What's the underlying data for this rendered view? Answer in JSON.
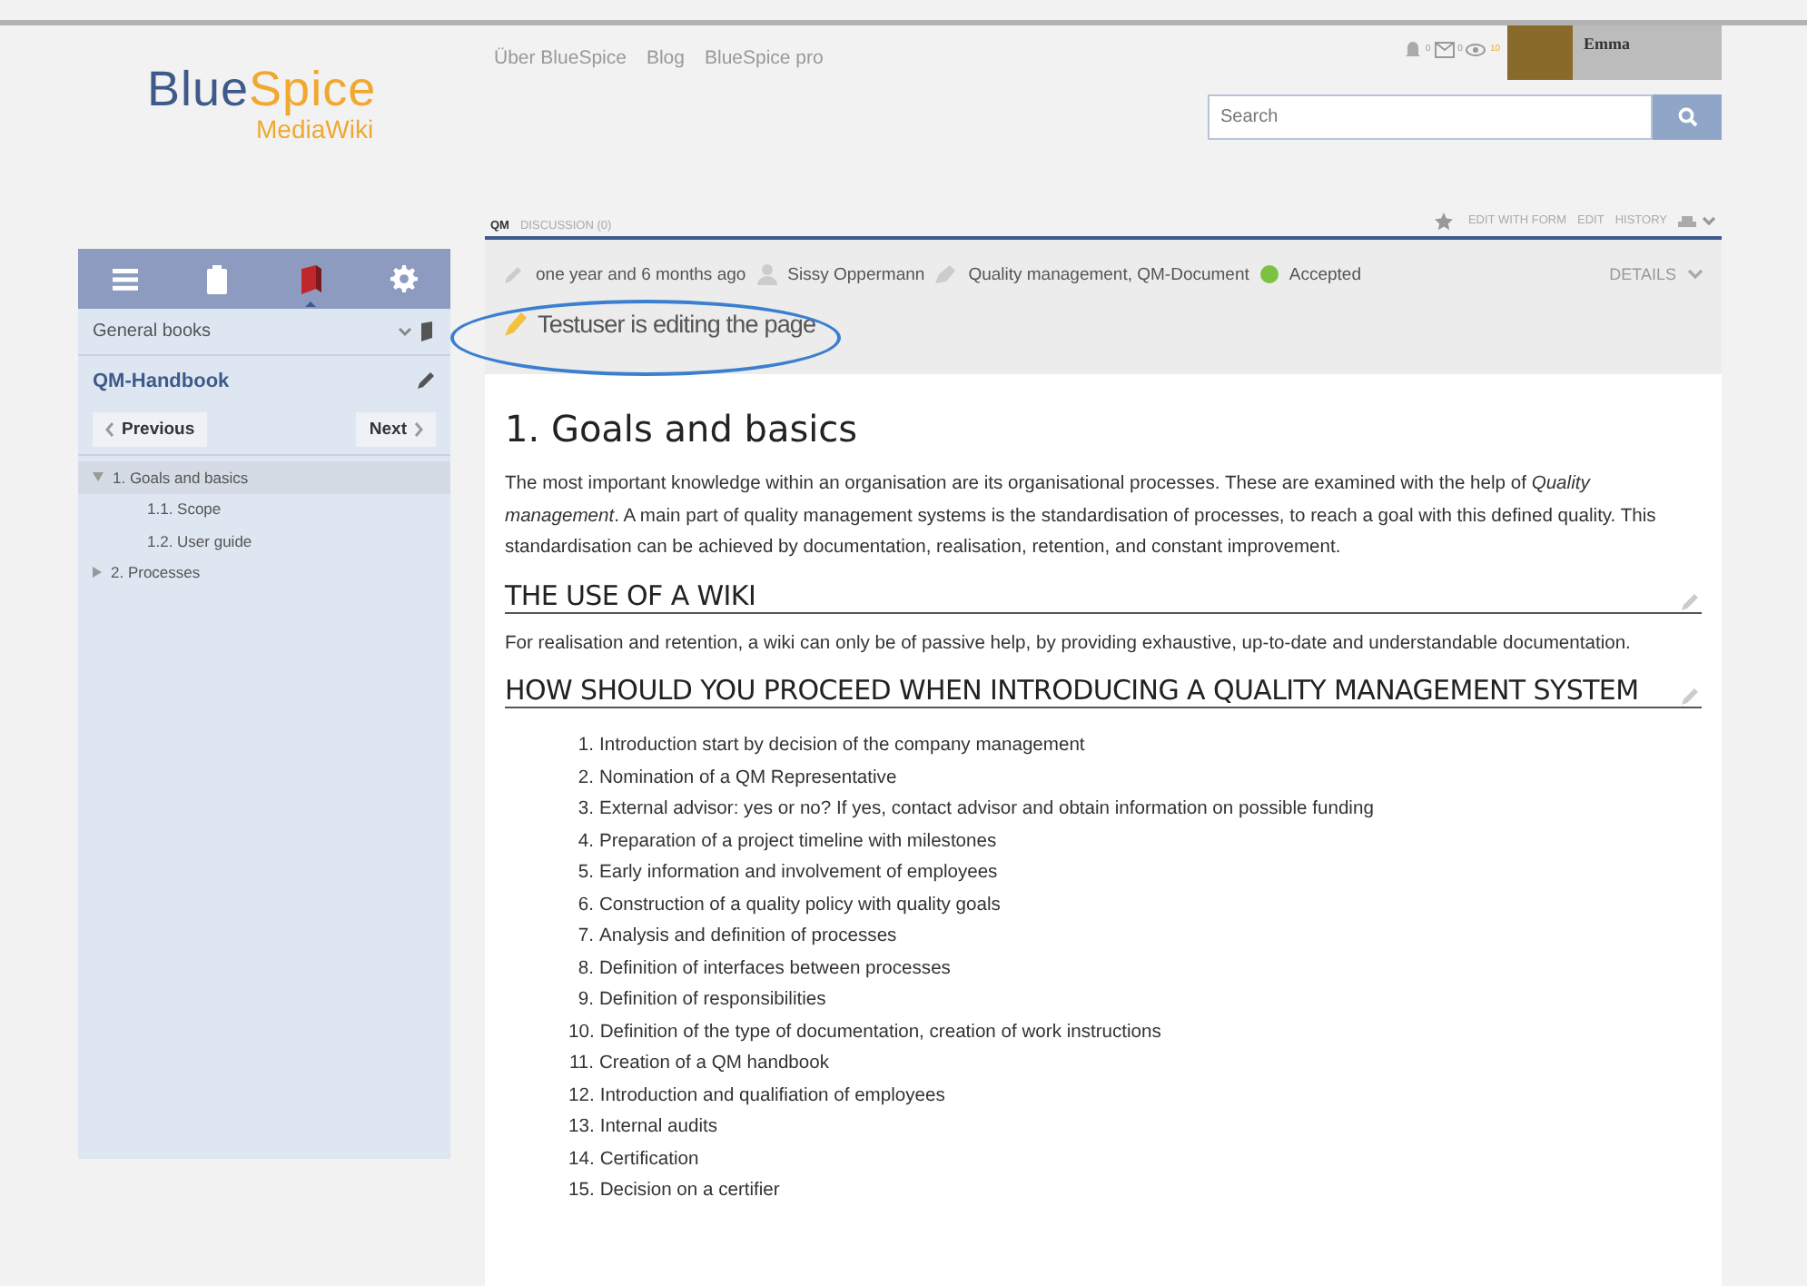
{
  "top_nav": [
    "Über BlueSpice",
    "Blog",
    "BlueSpice pro"
  ],
  "logo": {
    "primary": "Blue",
    "secondary": "Spice",
    "tagline": "MediaWiki"
  },
  "user": {
    "name": "Emma",
    "notification_count": "0",
    "message_count": "0",
    "watch_count": "10"
  },
  "search": {
    "placeholder": "Search"
  },
  "sidebar": {
    "tabs": [
      {
        "kind": "menu",
        "selected": false
      },
      {
        "kind": "clipboard",
        "selected": false
      },
      {
        "kind": "book",
        "selected": true
      },
      {
        "kind": "settings",
        "selected": false
      }
    ],
    "book_selector": "General books",
    "book_title": "QM-Handbook",
    "previous": "Previous",
    "next": "Next",
    "toc": [
      {
        "label": "1. Goals and basics",
        "expanded": true,
        "selected": true,
        "children": [
          {
            "label": "1.1. Scope",
            "selected": false
          },
          {
            "label": "1.2. User guide",
            "selected": false
          }
        ]
      },
      {
        "label": "2. Processes",
        "expanded": false,
        "selected": false
      }
    ]
  },
  "page_tabs": [
    {
      "label": "QM",
      "selected": true
    },
    {
      "label": "DISCUSSION (0)",
      "selected": false
    }
  ],
  "actions": [
    "EDIT WITH FORM",
    "EDIT",
    "HISTORY"
  ],
  "meta": {
    "modified": "one year and 6 months ago",
    "author": "Sissy Oppermann",
    "categories": "Quality management, QM-Document",
    "status": {
      "label": "Accepted",
      "color": "#7cc242"
    },
    "details": "DETAILS"
  },
  "editing_notice": "Testuser is editing the page",
  "content": {
    "title": "1. Goals and basics",
    "intro": "The most important knowledge within an organisation are its organisational processes. These are examined with the help of *Quality management*. A main part of quality management systems is the standardisation of processes, to reach a goal with this defined quality. This standardisation can be achieved by documentation, realisation, retention, and constant improvement.",
    "sections": [
      {
        "heading": "THE USE OF A WIKI",
        "paragraph": "For realisation and retention, a wiki can only be of passive help, by providing exhaustive, up-to-date and understandable documentation."
      },
      {
        "heading": "HOW SHOULD YOU PROCEED WHEN INTRODUCING A QUALITY MANAGEMENT SYSTEM",
        "list": [
          {
            "number": "1.",
            "text": "Introduction start by decision of the company management"
          },
          {
            "number": "2.",
            "text": "Nomination of a QM Representative"
          },
          {
            "number": "3.",
            "text": "External advisor: yes or no? If yes, contact advisor and obtain information on possible funding"
          },
          {
            "number": "4.",
            "text": "Preparation of a project timeline with milestones"
          },
          {
            "number": "5.",
            "text": "Early information and involvement of employees"
          },
          {
            "number": "6.",
            "text": "Construction of a quality policy with quality goals"
          },
          {
            "number": "7.",
            "text": "Analysis and definition of processes"
          },
          {
            "number": "8.",
            "text": "Definition of interfaces between processes"
          },
          {
            "number": "9.",
            "text": "Definition of responsibilities"
          },
          {
            "number": "10.",
            "text": "Definition of the type of documentation, creation of work instructions"
          },
          {
            "number": "11.",
            "text": "Creation of a QM handbook"
          },
          {
            "number": "12.",
            "text": "Introduction and qualifiation of employees"
          },
          {
            "number": "13.",
            "text": "Internal audits"
          },
          {
            "number": "14.",
            "text": "Certification"
          },
          {
            "number": "15.",
            "text": "Decision on a certifier"
          }
        ]
      }
    ]
  }
}
